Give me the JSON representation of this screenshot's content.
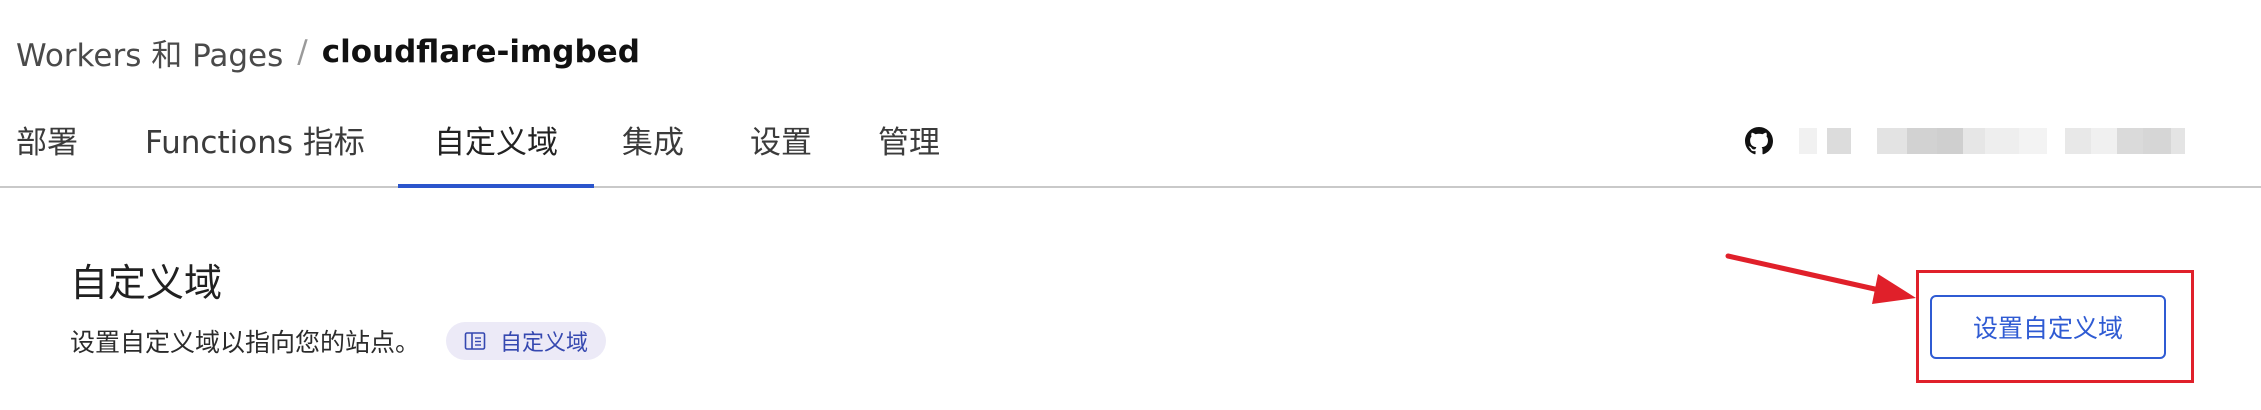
{
  "breadcrumb": {
    "parent": "Workers 和 Pages",
    "separator": "/",
    "current": "cloudflare-imgbed"
  },
  "tabs": [
    {
      "label": "部署"
    },
    {
      "label": "Functions 指标"
    },
    {
      "label": "自定义域",
      "active": true
    },
    {
      "label": "集成"
    },
    {
      "label": "设置"
    },
    {
      "label": "管理"
    }
  ],
  "repository": {
    "icon": "github-icon",
    "name_redacted": true
  },
  "section": {
    "title": "自定义域",
    "description": "设置自定义域以指向您的站点。",
    "doc_link_label": "自定义域",
    "doc_link_icon": "book-icon"
  },
  "actions": {
    "setup_button_label": "设置自定义域"
  },
  "annotation": {
    "arrow_color": "#e0202a",
    "box_color": "#e0202a"
  },
  "colors": {
    "accent": "#2f5bd3",
    "active_tab_underline": "#2b55cc"
  }
}
